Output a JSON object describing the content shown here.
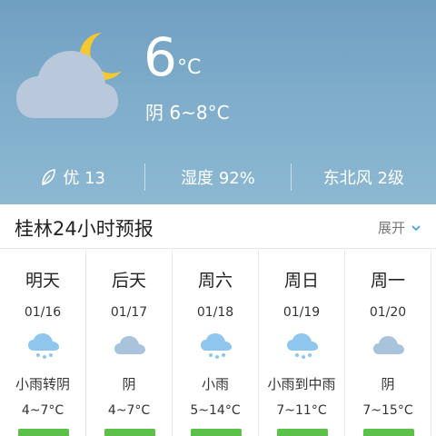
{
  "current": {
    "temperature": "6",
    "unit": "°C",
    "condition_range": "阴 6~8°C",
    "icon": "cloudy-night-icon"
  },
  "stats": {
    "air_quality": "优 13",
    "humidity": "湿度 92%",
    "wind": "东北风 2级"
  },
  "forecast": {
    "title": "桂林24小时预报",
    "expand_label": "展开",
    "days": [
      {
        "name": "明天",
        "date": "01/16",
        "condition": "小雨转阴",
        "temp": "4~7°C",
        "icon": "rain-cloud-icon"
      },
      {
        "name": "后天",
        "date": "01/17",
        "condition": "阴",
        "temp": "4~7°C",
        "icon": "cloud-icon"
      },
      {
        "name": "周六",
        "date": "01/18",
        "condition": "小雨",
        "temp": "5~14°C",
        "icon": "rain-cloud-icon"
      },
      {
        "name": "周日",
        "date": "01/19",
        "condition": "小雨到中雨",
        "temp": "7~11°C",
        "icon": "rain-cloud-icon"
      },
      {
        "name": "周一",
        "date": "01/20",
        "condition": "阴",
        "temp": "7~15°C",
        "icon": "cloud-icon"
      }
    ]
  },
  "colors": {
    "sky": "#7eacca",
    "moon": "#f6c830",
    "cloud_icon": "#a9c3dc",
    "rain_icon": "#8fc6ee",
    "aqi_good": "#5cc148"
  }
}
